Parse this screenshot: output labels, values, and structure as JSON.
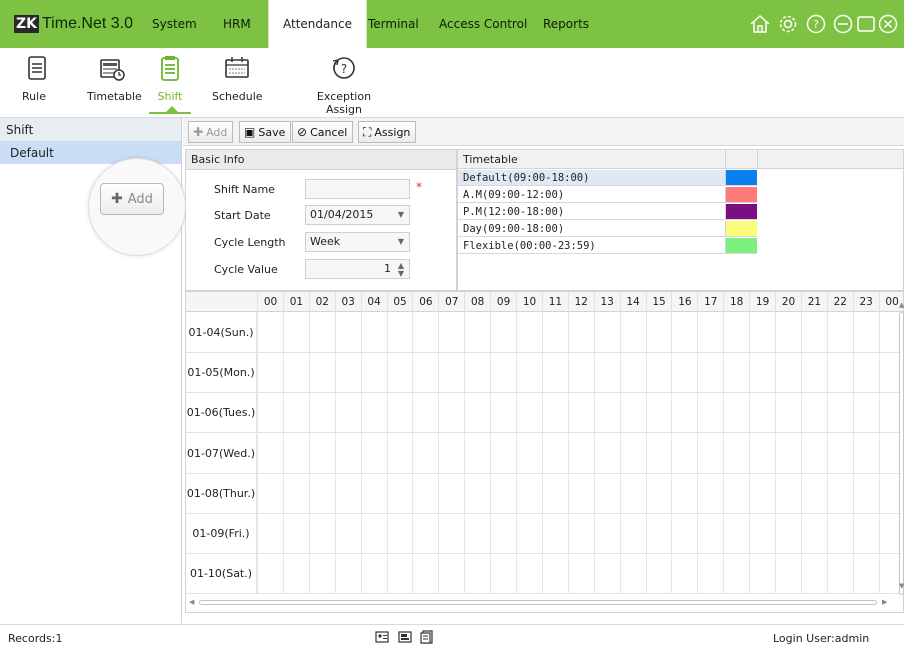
{
  "app": {
    "badge": "ZK",
    "name": "Time.Net 3.0"
  },
  "menu": [
    "System",
    "HRM",
    "Attendance",
    "Terminal",
    "Access Control",
    "Reports"
  ],
  "active_menu": "Attendance",
  "window_icons": [
    "home-icon",
    "settings-icon",
    "help-icon",
    "minimize-icon",
    "maximize-icon",
    "close-icon"
  ],
  "toolbar": [
    {
      "label": "Rule",
      "icon": "rule-icon"
    },
    {
      "label": "Timetable",
      "icon": "timetable-icon"
    },
    {
      "label": "Shift",
      "icon": "shift-icon",
      "active": true
    },
    {
      "label": "Schedule",
      "icon": "schedule-icon"
    },
    {
      "label": "Exception Assign",
      "icon": "exception-assign-icon"
    }
  ],
  "left": {
    "header": "Shift",
    "items": [
      "Default"
    ],
    "magnified_add": "Add"
  },
  "actions": {
    "add": "Add",
    "save": "Save",
    "cancel": "Cancel",
    "assign": "Assign"
  },
  "basic_info": {
    "title": "Basic Info",
    "shift_name_label": "Shift Name",
    "shift_name_value": "",
    "start_date_label": "Start Date",
    "start_date_value": "01/04/2015",
    "cycle_length_label": "Cycle Length",
    "cycle_length_value": "Week",
    "cycle_value_label": "Cycle Value",
    "cycle_value_value": "1"
  },
  "timetable": {
    "title": "Timetable",
    "rows": [
      {
        "name": "Default(09:00-18:00)",
        "color": "#0a7ff0",
        "selected": true
      },
      {
        "name": "A.M(09:00-12:00)",
        "color": "#ff7b7b"
      },
      {
        "name": "P.M(12:00-18:00)",
        "color": "#7a0f84"
      },
      {
        "name": "Day(09:00-18:00)",
        "color": "#fbfb7a"
      },
      {
        "name": "Flexible(00:00-23:59)",
        "color": "#7ef07e"
      }
    ]
  },
  "grid": {
    "hours": [
      "00",
      "01",
      "02",
      "03",
      "04",
      "05",
      "06",
      "07",
      "08",
      "09",
      "10",
      "11",
      "12",
      "13",
      "14",
      "15",
      "16",
      "17",
      "18",
      "19",
      "20",
      "21",
      "22",
      "23",
      "00"
    ],
    "days": [
      "01-04(Sun.)",
      "01-05(Mon.)",
      "01-06(Tues.)",
      "01-07(Wed.)",
      "01-08(Thur.)",
      "01-09(Fri.)",
      "01-10(Sat.)"
    ]
  },
  "status": {
    "records": "Records:1",
    "login": "Login User:admin"
  }
}
